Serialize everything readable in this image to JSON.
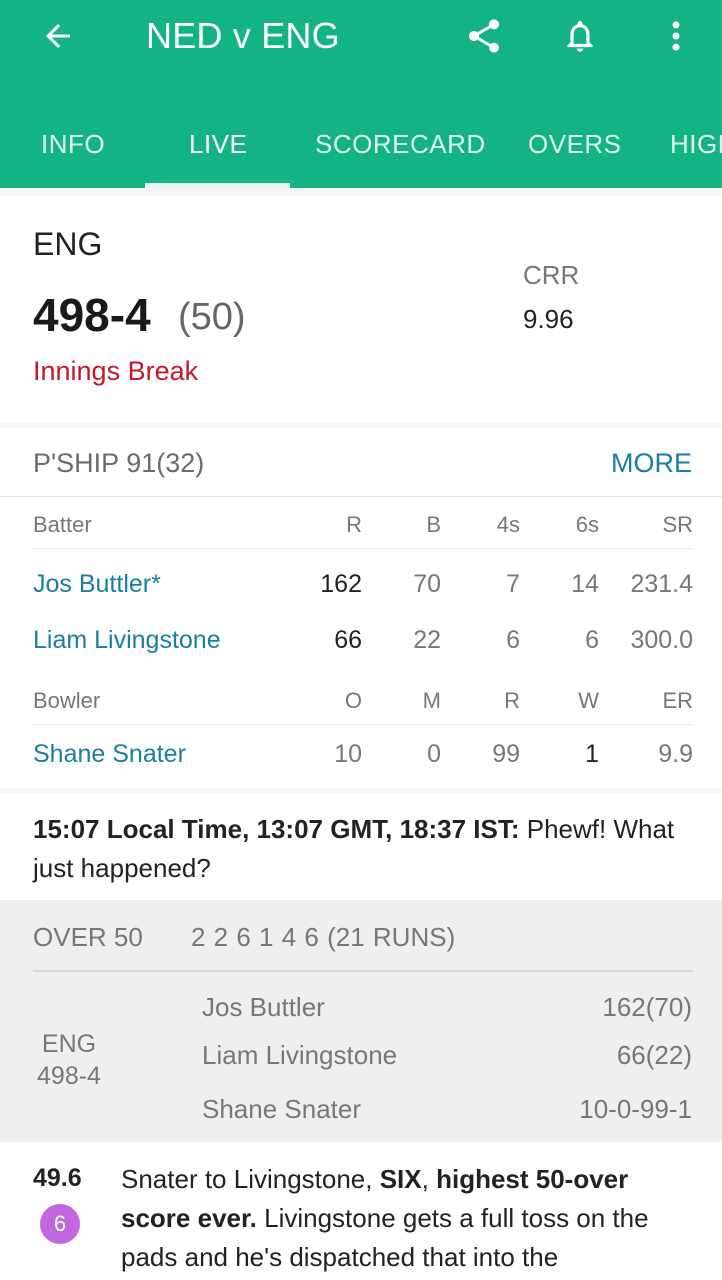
{
  "header": {
    "title": "NED v ENG",
    "tabs": [
      "INFO",
      "LIVE",
      "SCORECARD",
      "OVERS",
      "HIGHLIGHTS"
    ],
    "active_tab": "LIVE",
    "colors": {
      "bar": "#13b386"
    }
  },
  "score": {
    "team": "ENG",
    "runs": "498-4",
    "overs": "(50)",
    "status": "Innings Break",
    "crr_label": "CRR",
    "crr_value": "9.96"
  },
  "partnership": {
    "label": "P'SHIP",
    "value": "91(32)",
    "more": "MORE"
  },
  "batting": {
    "headers": [
      "Batter",
      "R",
      "B",
      "4s",
      "6s",
      "SR"
    ],
    "rows": [
      {
        "name": "Jos Buttler*",
        "r": "162",
        "b": "70",
        "fours": "7",
        "sixes": "14",
        "sr": "231.4"
      },
      {
        "name": "Liam Livingstone",
        "r": "66",
        "b": "22",
        "fours": "6",
        "sixes": "6",
        "sr": "300.0"
      }
    ]
  },
  "bowling": {
    "headers": [
      "Bowler",
      "O",
      "M",
      "R",
      "W",
      "ER"
    ],
    "rows": [
      {
        "name": "Shane Snater",
        "o": "10",
        "m": "0",
        "r": "99",
        "w": "1",
        "er": "9.9"
      }
    ]
  },
  "note": {
    "bold": "15:07 Local Time, 13:07 GMT, 18:37 IST:",
    "text": " Phewf! What just happened?"
  },
  "over": {
    "label": "OVER 50",
    "balls": "2 2 6 1 4 6 (21 RUNS)",
    "team": "ENG",
    "team_score": "498-4",
    "lines": [
      {
        "name": "Jos Buttler",
        "value": "162(70)"
      },
      {
        "name": "Liam Livingstone",
        "value": "66(22)"
      },
      {
        "name": "Shane Snater",
        "value": "10-0-99-1"
      }
    ]
  },
  "ball": {
    "number": "49.6",
    "badge": "6",
    "text_1": "Snater to Livingstone, ",
    "text_2": "SIX",
    "text_3": ", ",
    "text_4": "highest 50-over score ever.",
    "text_5": " Livingstone gets a full toss on the pads and he's dispatched that into the"
  }
}
